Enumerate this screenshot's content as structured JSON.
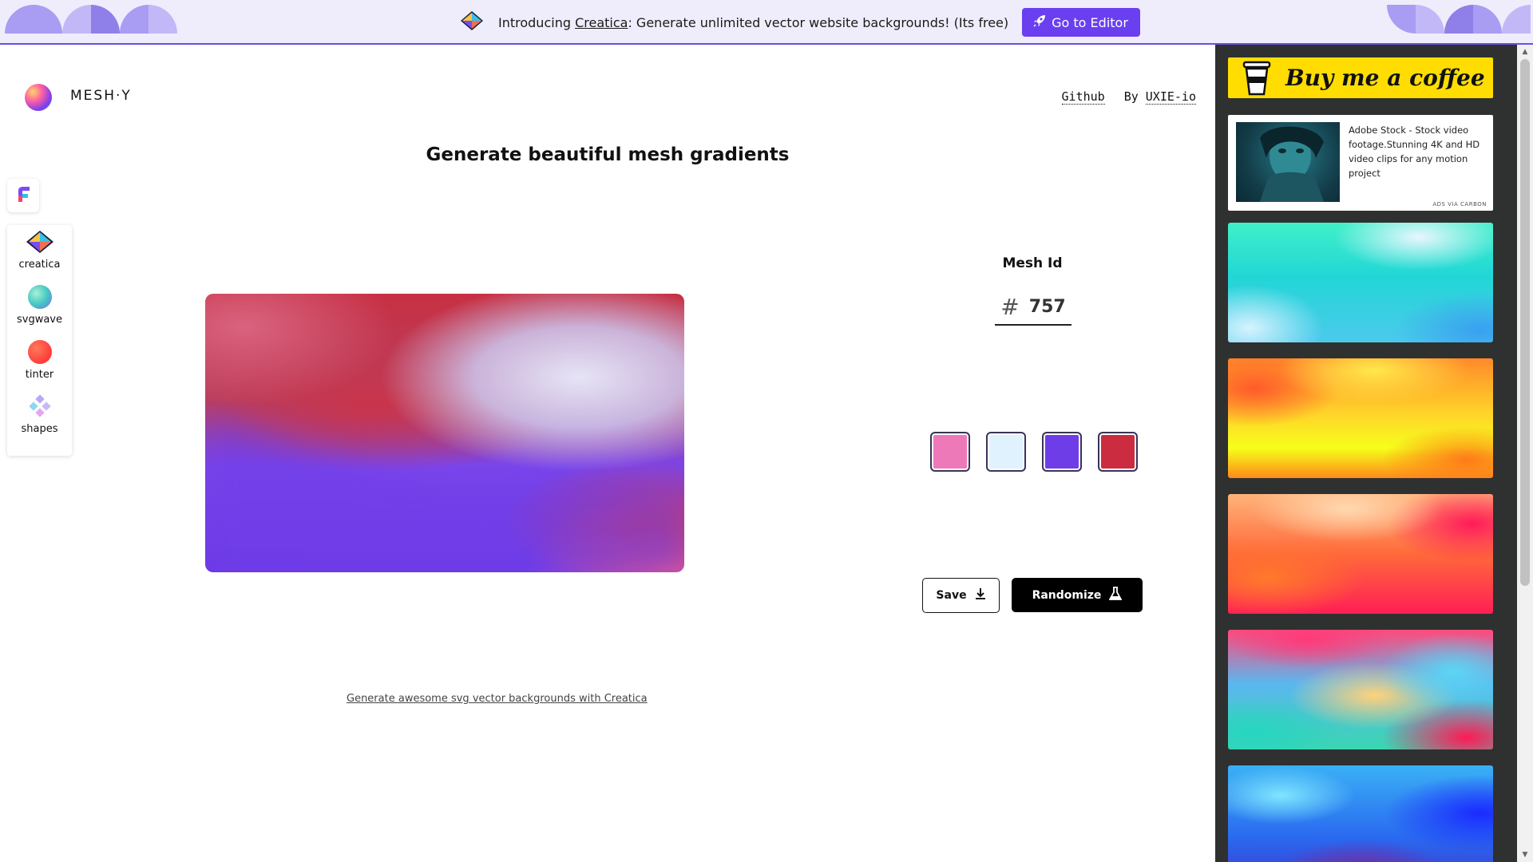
{
  "banner": {
    "intro": "Introducing ",
    "link": "Creatica",
    "text": ": Generate unlimited vector website backgrounds! (Its free)",
    "button_label": "Go to Editor",
    "button_icon": "rocket-icon",
    "logo_icon": "creatica-logo-icon"
  },
  "header": {
    "logo_text": "MESH·Y",
    "github": "Github",
    "by_prefix": "By ",
    "by_link": "UXIE-io"
  },
  "title": "Generate beautiful mesh gradients",
  "rail": {
    "items": [
      {
        "label": "creatica",
        "icon": "creatica-icon"
      },
      {
        "label": "svgwave",
        "icon": "svgwave-icon"
      },
      {
        "label": "tinter",
        "icon": "tinter-icon"
      },
      {
        "label": "shapes",
        "icon": "shapes-icon"
      }
    ]
  },
  "mesh": {
    "label": "Mesh Id",
    "hash": "#",
    "id": "757",
    "colors": [
      "#ee79b9",
      "#e0f2fe",
      "#6f3de8",
      "#cc2c3f"
    ]
  },
  "actions": {
    "save": "Save",
    "randomize": "Randomize"
  },
  "footer": {
    "link": "Generate awesome svg vector backgrounds with Creatica"
  },
  "sidebar": {
    "coffee": "Buy me a coffee",
    "ad_text": "Adobe Stock - Stock video footage.Stunning 4K and HD video clips for any motion project",
    "ad_via": "ADS VIA CARBON"
  },
  "colors": {
    "accent": "#6a3ff0",
    "banner_bg": "#efedfb",
    "sidebar_bg": "#2f3030",
    "coffee_yellow": "#ffdd00"
  }
}
